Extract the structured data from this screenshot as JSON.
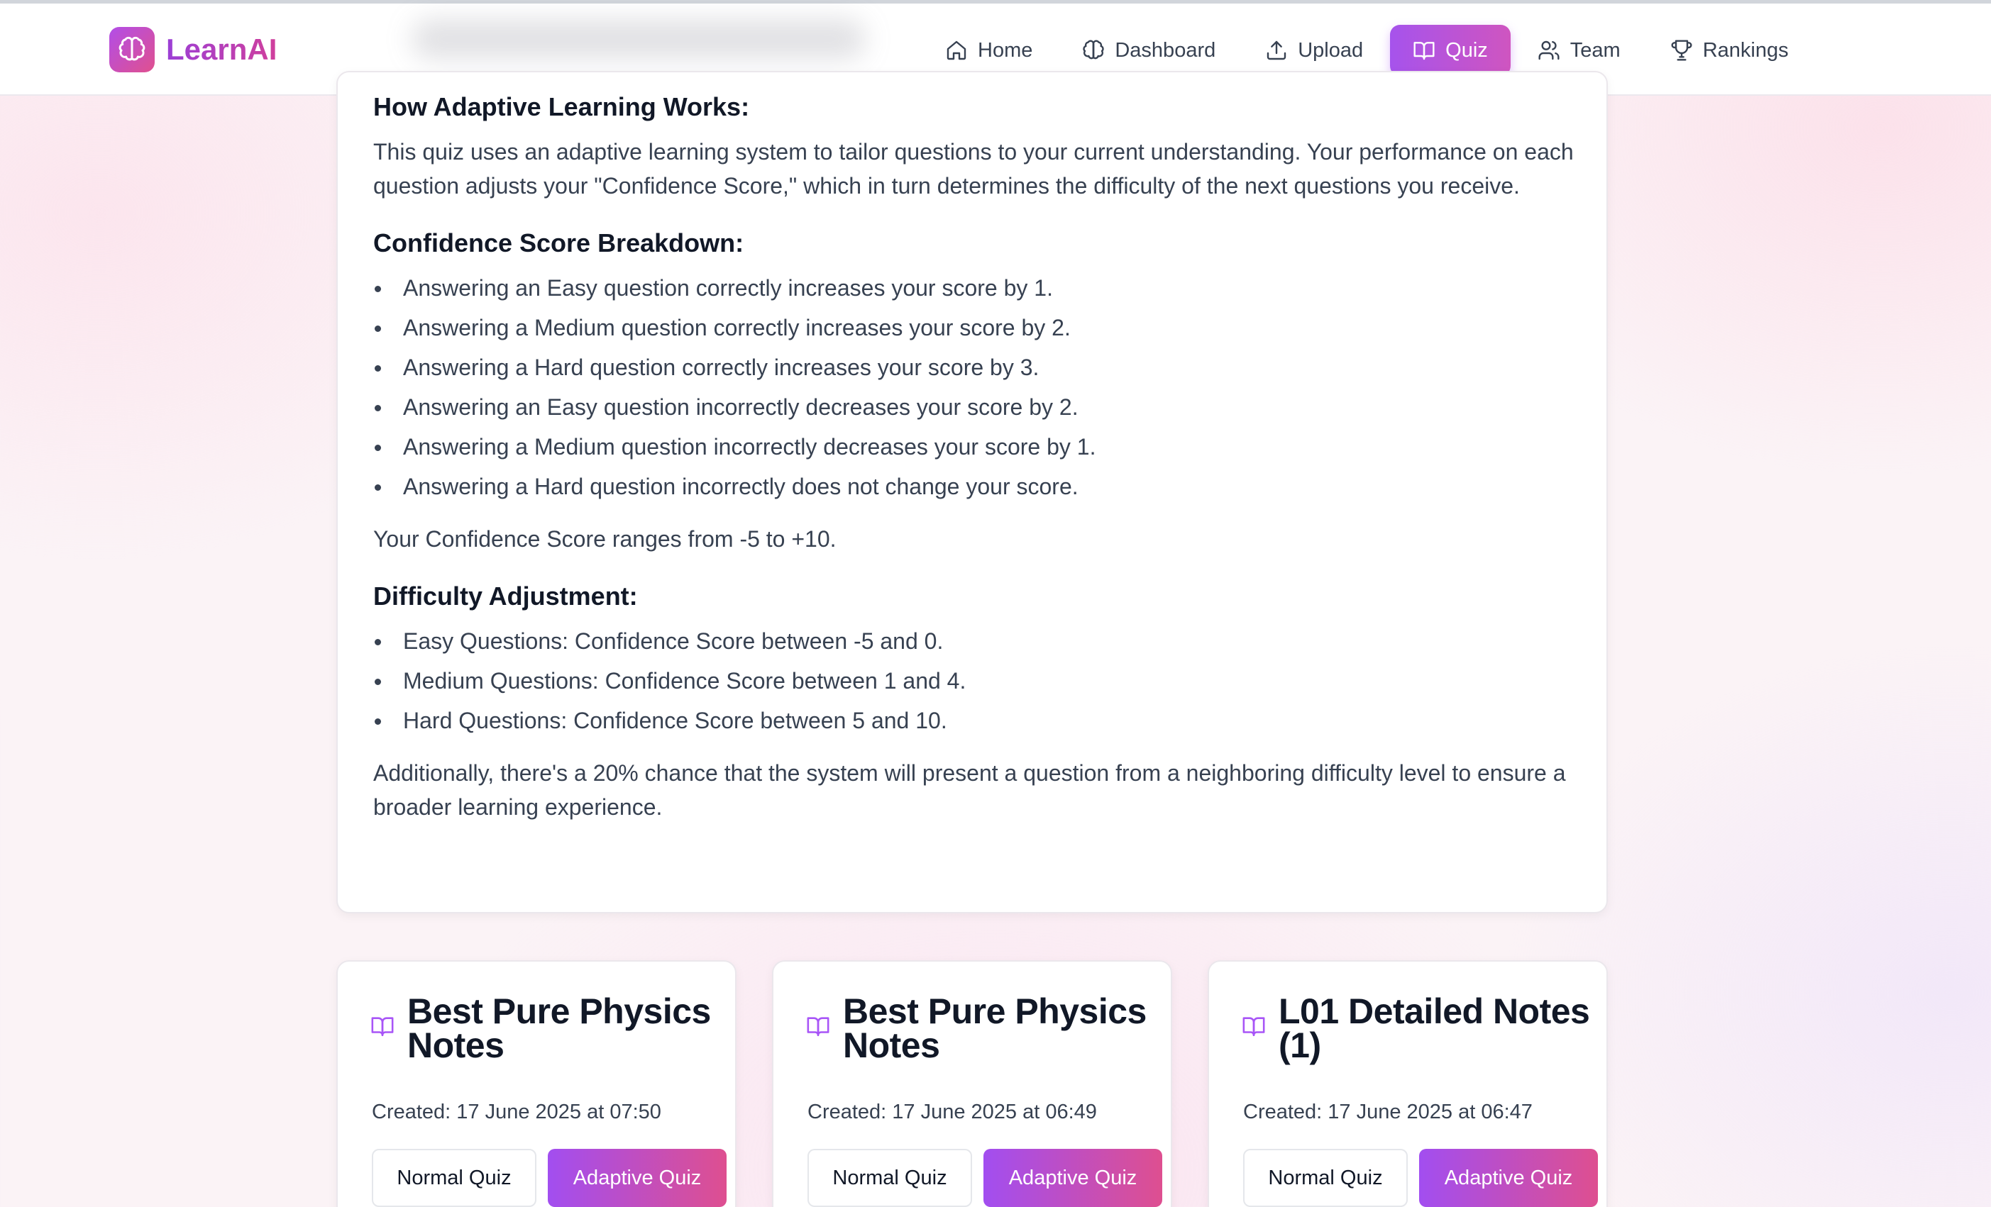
{
  "brand": {
    "name": "LearnAI",
    "icon": "brain-icon",
    "gradient": [
      "#b24ee8",
      "#e0508e"
    ]
  },
  "nav": {
    "items": [
      {
        "label": "Home",
        "icon": "home-icon",
        "active": false
      },
      {
        "label": "Dashboard",
        "icon": "brain-icon",
        "active": false
      },
      {
        "label": "Upload",
        "icon": "upload-icon",
        "active": false
      },
      {
        "label": "Quiz",
        "icon": "book-open-icon",
        "active": true
      },
      {
        "label": "Team",
        "icon": "users-icon",
        "active": false
      },
      {
        "label": "Rankings",
        "icon": "trophy-icon",
        "active": false
      }
    ],
    "active_color": "#a855f7"
  },
  "info": {
    "how_heading": "How Adaptive Learning Works:",
    "how_text": "This quiz uses an adaptive learning system to tailor questions to your current understanding. Your performance on each question adjusts your \"Confidence Score,\" which in turn determines the difficulty of the next questions you receive.",
    "breakdown_heading": "Confidence Score Breakdown:",
    "breakdown": [
      "Answering an Easy question correctly increases your score by 1.",
      "Answering a Medium question correctly increases your score by 2.",
      "Answering a Hard question correctly increases your score by 3.",
      "Answering an Easy question incorrectly decreases your score by 2.",
      "Answering a Medium question incorrectly decreases your score by 1.",
      "Answering a Hard question incorrectly does not change your score."
    ],
    "range_text": "Your Confidence Score ranges from -5 to +10.",
    "difficulty_heading": "Difficulty Adjustment:",
    "difficulty": [
      "Easy Questions: Confidence Score between -5 and 0.",
      "Medium Questions: Confidence Score between 1 and 4.",
      "Hard Questions: Confidence Score between 5 and 10."
    ],
    "additional_text": "Additionally, there's a 20% chance that the system will present a question from a neighboring difficulty level to ensure a broader learning experience."
  },
  "notes": [
    {
      "title": "Best Pure Physics Notes",
      "created": "Created: 17 June 2025 at 07:50",
      "normal_label": "Normal Quiz",
      "adaptive_label": "Adaptive Quiz"
    },
    {
      "title": "Best Pure Physics Notes",
      "created": "Created: 17 June 2025 at 06:49",
      "normal_label": "Normal Quiz",
      "adaptive_label": "Adaptive Quiz"
    },
    {
      "title": "L01 Detailed Notes (1)",
      "created": "Created: 17 June 2025 at 06:47",
      "normal_label": "Normal Quiz",
      "adaptive_label": "Adaptive Quiz"
    }
  ]
}
